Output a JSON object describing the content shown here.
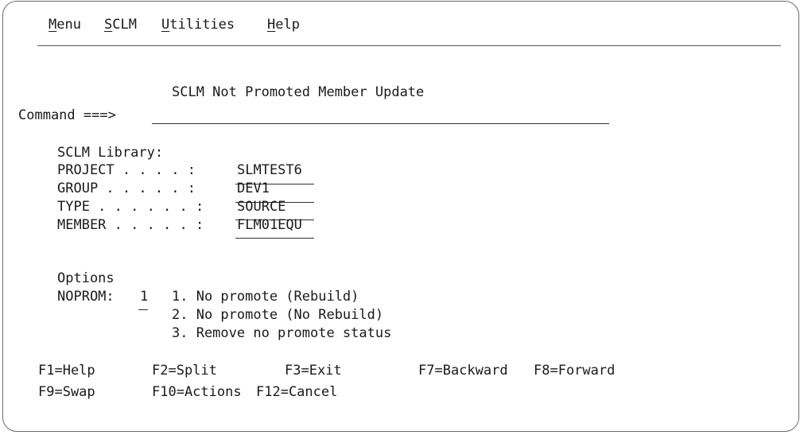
{
  "menubar": {
    "items": [
      {
        "label": "Menu",
        "accel": "M",
        "rest": "enu"
      },
      {
        "label": "SCLM",
        "accel": "S",
        "rest": "CLM"
      },
      {
        "label": "Utilities",
        "accel": "U",
        "rest": "tilities"
      },
      {
        "label": "Help",
        "accel": "H",
        "rest": "elp"
      }
    ]
  },
  "panel": {
    "title": "SCLM Not Promoted Member Update",
    "command_label": "Command ===>",
    "command_value": ""
  },
  "library": {
    "heading": "SCLM Library:",
    "fields": [
      {
        "label": "PROJECT . . . . :",
        "value": "SLMTEST6"
      },
      {
        "label": "GROUP . . . . . :",
        "value": "DEV1"
      },
      {
        "label": "TYPE . . . . . . :",
        "value": "SOURCE"
      },
      {
        "label": "MEMBER . . . . . :",
        "value": "FLM01EQU"
      }
    ]
  },
  "options": {
    "heading": "Options",
    "noprom_label": "NOPROM:",
    "noprom_value": "1",
    "choices": [
      "1. No promote (Rebuild)",
      "2. No promote (No Rebuild)",
      "3. Remove no promote status"
    ]
  },
  "fkeys": {
    "row1": [
      "F1=Help",
      "F2=Split",
      "F3=Exit",
      "F7=Backward",
      "F8=Forward"
    ],
    "row2": [
      "F9=Swap",
      "F10=Actions",
      "F12=Cancel"
    ]
  }
}
